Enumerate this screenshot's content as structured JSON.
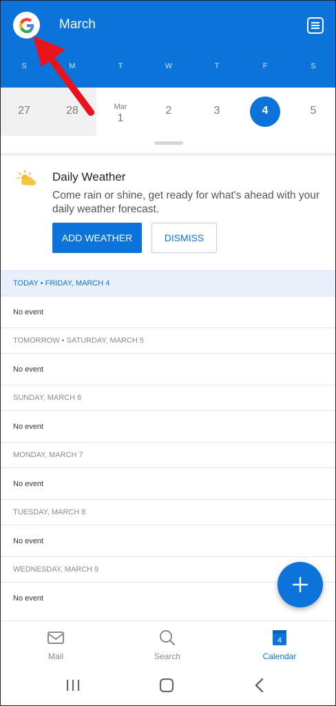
{
  "header": {
    "title": "March",
    "account_icon": "google-g-icon",
    "menu_icon": "calendar-list-icon",
    "weekdays": [
      "S",
      "M",
      "T",
      "W",
      "T",
      "F",
      "S"
    ]
  },
  "date_strip": {
    "days": [
      {
        "num": "27",
        "month": ""
      },
      {
        "num": "28",
        "month": ""
      },
      {
        "num": "1",
        "month": "Mar"
      },
      {
        "num": "2",
        "month": ""
      },
      {
        "num": "3",
        "month": ""
      },
      {
        "num": "4",
        "month": ""
      },
      {
        "num": "5",
        "month": ""
      }
    ],
    "selected_index": 5
  },
  "weather_card": {
    "icon": "partly-cloudy-icon",
    "title": "Daily Weather",
    "description": "Come rain or shine, get ready for what's ahead with your daily weather forecast.",
    "add_label": "ADD WEATHER",
    "dismiss_label": "DISMISS"
  },
  "agenda": {
    "days": [
      {
        "header": "TODAY • FRIDAY, MARCH 4",
        "event": "No event"
      },
      {
        "header": "TOMORROW • SATURDAY, MARCH 5",
        "event": "No event"
      },
      {
        "header": "SUNDAY, MARCH 6",
        "event": "No event"
      },
      {
        "header": "MONDAY, MARCH 7",
        "event": "No event"
      },
      {
        "header": "TUESDAY, MARCH 8",
        "event": "No event"
      },
      {
        "header": "WEDNESDAY, MARCH 9",
        "event": "No event"
      }
    ]
  },
  "fab": {
    "icon": "plus-icon"
  },
  "bottom_nav": {
    "mail": "Mail",
    "search": "Search",
    "calendar": "Calendar",
    "calendar_badge": "4",
    "active": "Calendar"
  },
  "colors": {
    "accent": "#0B73D9",
    "annotation_arrow": "#E8141B"
  }
}
